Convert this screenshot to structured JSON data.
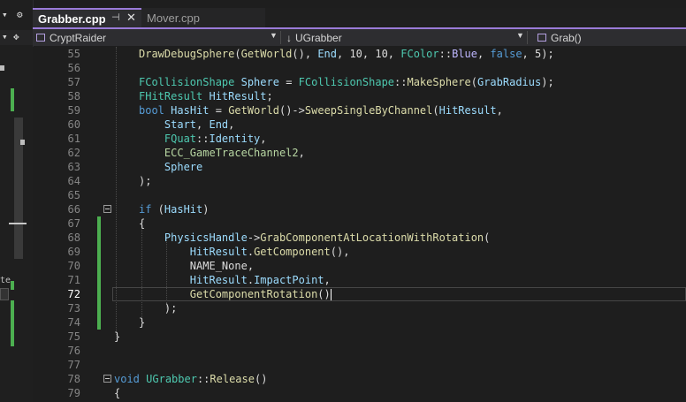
{
  "left_panel": {
    "top_glyphs": [
      "▾",
      "⚙"
    ],
    "second_glyphs": [
      "▾",
      "✥"
    ],
    "peek_text": "te"
  },
  "tabs": [
    {
      "label": "Grabber.cpp",
      "active": true,
      "pin": "⊣",
      "close": "✕"
    },
    {
      "label": "Mover.cpp",
      "active": false
    }
  ],
  "navbar": {
    "project": "CryptRaider",
    "class_scope": "UGrabber",
    "member_scope": "Grab()"
  },
  "editor": {
    "current_line": "72",
    "lines": [
      {
        "num": "55",
        "tokens": [
          [
            "DrawDebugSphere",
            "f"
          ],
          [
            "(",
            ""
          ],
          [
            "GetWorld",
            "f"
          ],
          [
            "(), ",
            ""
          ],
          [
            "End",
            "v"
          ],
          [
            ", 10, 10, ",
            ""
          ],
          [
            "FColor",
            "t"
          ],
          [
            "::",
            ""
          ],
          [
            "Blue",
            "m"
          ],
          [
            ", ",
            ""
          ],
          [
            "false",
            "k"
          ],
          [
            ", 5);",
            ""
          ]
        ]
      },
      {
        "num": "56",
        "tokens": []
      },
      {
        "num": "57",
        "tokens": [
          [
            "FCollisionShape",
            "t"
          ],
          [
            " ",
            ""
          ],
          [
            "Sphere",
            "v"
          ],
          [
            " = ",
            ""
          ],
          [
            "FCollisionShape",
            "t"
          ],
          [
            "::",
            ""
          ],
          [
            "MakeSphere",
            "f"
          ],
          [
            "(",
            ""
          ],
          [
            "GrabRadius",
            "v"
          ],
          [
            ");",
            ""
          ]
        ]
      },
      {
        "num": "58",
        "tokens": [
          [
            "FHitResult",
            "t"
          ],
          [
            " ",
            ""
          ],
          [
            "HitResult",
            "v"
          ],
          [
            ";",
            ""
          ]
        ]
      },
      {
        "num": "59",
        "tokens": [
          [
            "bool",
            "k"
          ],
          [
            " ",
            ""
          ],
          [
            "HasHit",
            "v"
          ],
          [
            " = ",
            ""
          ],
          [
            "GetWorld",
            "f"
          ],
          [
            "()->",
            ""
          ],
          [
            "SweepSingleByChannel",
            "f"
          ],
          [
            "(",
            ""
          ],
          [
            "HitResult",
            "v"
          ],
          [
            ",",
            ""
          ]
        ]
      },
      {
        "num": "60",
        "tokens": [
          [
            "    ",
            ""
          ],
          [
            "Start",
            "v"
          ],
          [
            ", ",
            ""
          ],
          [
            "End",
            "v"
          ],
          [
            ",",
            ""
          ]
        ]
      },
      {
        "num": "61",
        "tokens": [
          [
            "    ",
            ""
          ],
          [
            "FQuat",
            "t"
          ],
          [
            "::",
            ""
          ],
          [
            "Identity",
            "v"
          ],
          [
            ",",
            ""
          ]
        ]
      },
      {
        "num": "62",
        "tokens": [
          [
            "    ",
            ""
          ],
          [
            "ECC_GameTraceChannel2",
            "e"
          ],
          [
            ",",
            ""
          ]
        ]
      },
      {
        "num": "63",
        "tokens": [
          [
            "    ",
            ""
          ],
          [
            "Sphere",
            "v"
          ]
        ]
      },
      {
        "num": "64",
        "tokens": [
          [
            ");",
            ""
          ]
        ]
      },
      {
        "num": "65",
        "tokens": []
      },
      {
        "num": "66",
        "tokens": [
          [
            "if",
            "k"
          ],
          [
            " (",
            ""
          ],
          [
            "HasHit",
            "v"
          ],
          [
            ")",
            ""
          ]
        ]
      },
      {
        "num": "67",
        "tokens": [
          [
            "{",
            ""
          ]
        ]
      },
      {
        "num": "68",
        "tokens": [
          [
            "    ",
            ""
          ],
          [
            "PhysicsHandle",
            "v"
          ],
          [
            "->",
            ""
          ],
          [
            "GrabComponentAtLocationWithRotation",
            "f"
          ],
          [
            "(",
            ""
          ]
        ]
      },
      {
        "num": "69",
        "tokens": [
          [
            "        ",
            ""
          ],
          [
            "HitResult",
            "v"
          ],
          [
            ".",
            ""
          ],
          [
            "GetComponent",
            "f"
          ],
          [
            "(),",
            ""
          ]
        ]
      },
      {
        "num": "70",
        "tokens": [
          [
            "        NAME_None,",
            ""
          ]
        ]
      },
      {
        "num": "71",
        "tokens": [
          [
            "        ",
            ""
          ],
          [
            "HitResult",
            "v"
          ],
          [
            ".",
            ""
          ],
          [
            "ImpactPoint",
            "v"
          ],
          [
            ",",
            ""
          ]
        ]
      },
      {
        "num": "72",
        "tokens": [
          [
            "        ",
            ""
          ],
          [
            "GetComponentRotation",
            "f"
          ],
          [
            "()",
            ""
          ]
        ]
      },
      {
        "num": "73",
        "tokens": [
          [
            "    );",
            ""
          ]
        ]
      },
      {
        "num": "74",
        "tokens": [
          [
            "}",
            ""
          ]
        ]
      },
      {
        "num": "75",
        "tokens": [
          [
            "}",
            ""
          ]
        ]
      },
      {
        "num": "76",
        "tokens": []
      },
      {
        "num": "77",
        "tokens": []
      },
      {
        "num": "78",
        "tokens": [
          [
            "void",
            "k"
          ],
          [
            " ",
            ""
          ],
          [
            "UGrabber",
            "t"
          ],
          [
            "::",
            ""
          ],
          [
            "Release",
            "f"
          ],
          [
            "()",
            ""
          ]
        ]
      },
      {
        "num": "79",
        "tokens": [
          [
            "{",
            ""
          ]
        ]
      }
    ]
  },
  "colors": {
    "accent": "#9a7bd8",
    "changed_marker": "#4caf50",
    "keyword": "#569cd6",
    "type": "#4ec9b0",
    "function": "#dcdcaa",
    "variable": "#9cdcfe",
    "enum": "#b8d7a3"
  }
}
